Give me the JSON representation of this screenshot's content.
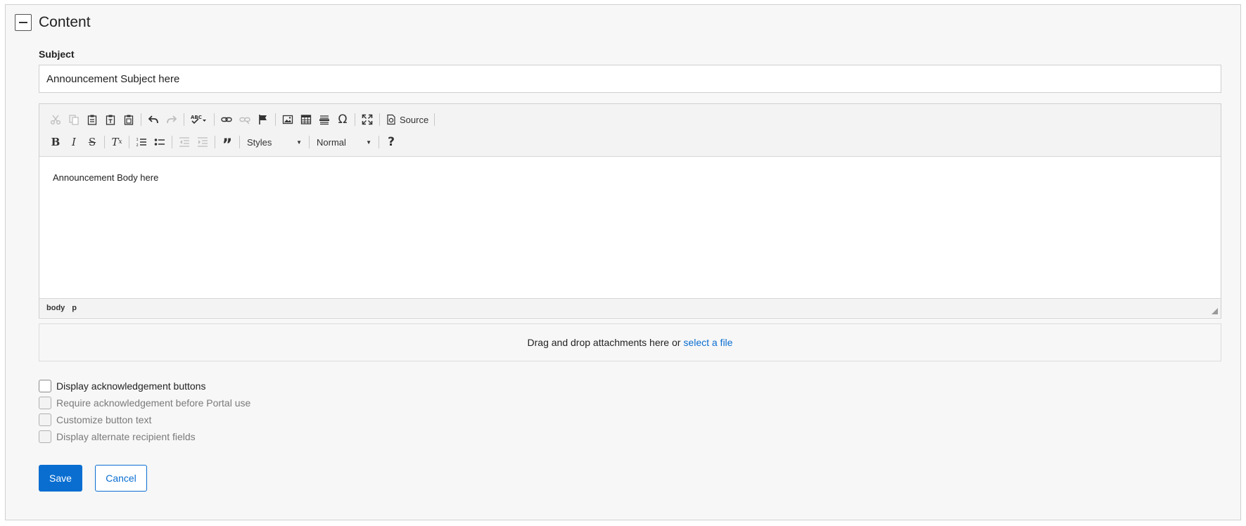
{
  "section": {
    "title": "Content"
  },
  "subject": {
    "label": "Subject",
    "value": "Announcement Subject here"
  },
  "editor": {
    "toolbar": {
      "source_label": "Source",
      "styles_label": "Styles",
      "format_label": "Normal",
      "help_label": "?"
    },
    "body_text": "Announcement Body here",
    "path": [
      "body",
      "p"
    ]
  },
  "attachments": {
    "prompt": "Drag and drop attachments here or",
    "link": "select a file"
  },
  "options": [
    {
      "label": "Display acknowledgement buttons",
      "enabled": true,
      "checked": false
    },
    {
      "label": "Require acknowledgement before Portal use",
      "enabled": false,
      "checked": false
    },
    {
      "label": "Customize button text",
      "enabled": false,
      "checked": false
    },
    {
      "label": "Display alternate recipient fields",
      "enabled": false,
      "checked": false
    }
  ],
  "buttons": {
    "save": "Save",
    "cancel": "Cancel"
  },
  "colors": {
    "accent": "#0a6ed1",
    "panel_bg": "#f7f7f7"
  },
  "icons": [
    "minus-icon",
    "cut-icon",
    "copy-icon",
    "paste-icon",
    "paste-text-icon",
    "paste-word-icon",
    "undo-icon",
    "redo-icon",
    "spellcheck-icon",
    "link-icon",
    "unlink-icon",
    "anchor-icon",
    "image-icon",
    "table-icon",
    "horizontal-rule-icon",
    "special-char-icon",
    "maximize-icon",
    "source-icon",
    "bold-icon",
    "italic-icon",
    "strikethrough-icon",
    "remove-format-icon",
    "numbered-list-icon",
    "bulleted-list-icon",
    "outdent-icon",
    "indent-icon",
    "blockquote-icon",
    "help-icon"
  ]
}
